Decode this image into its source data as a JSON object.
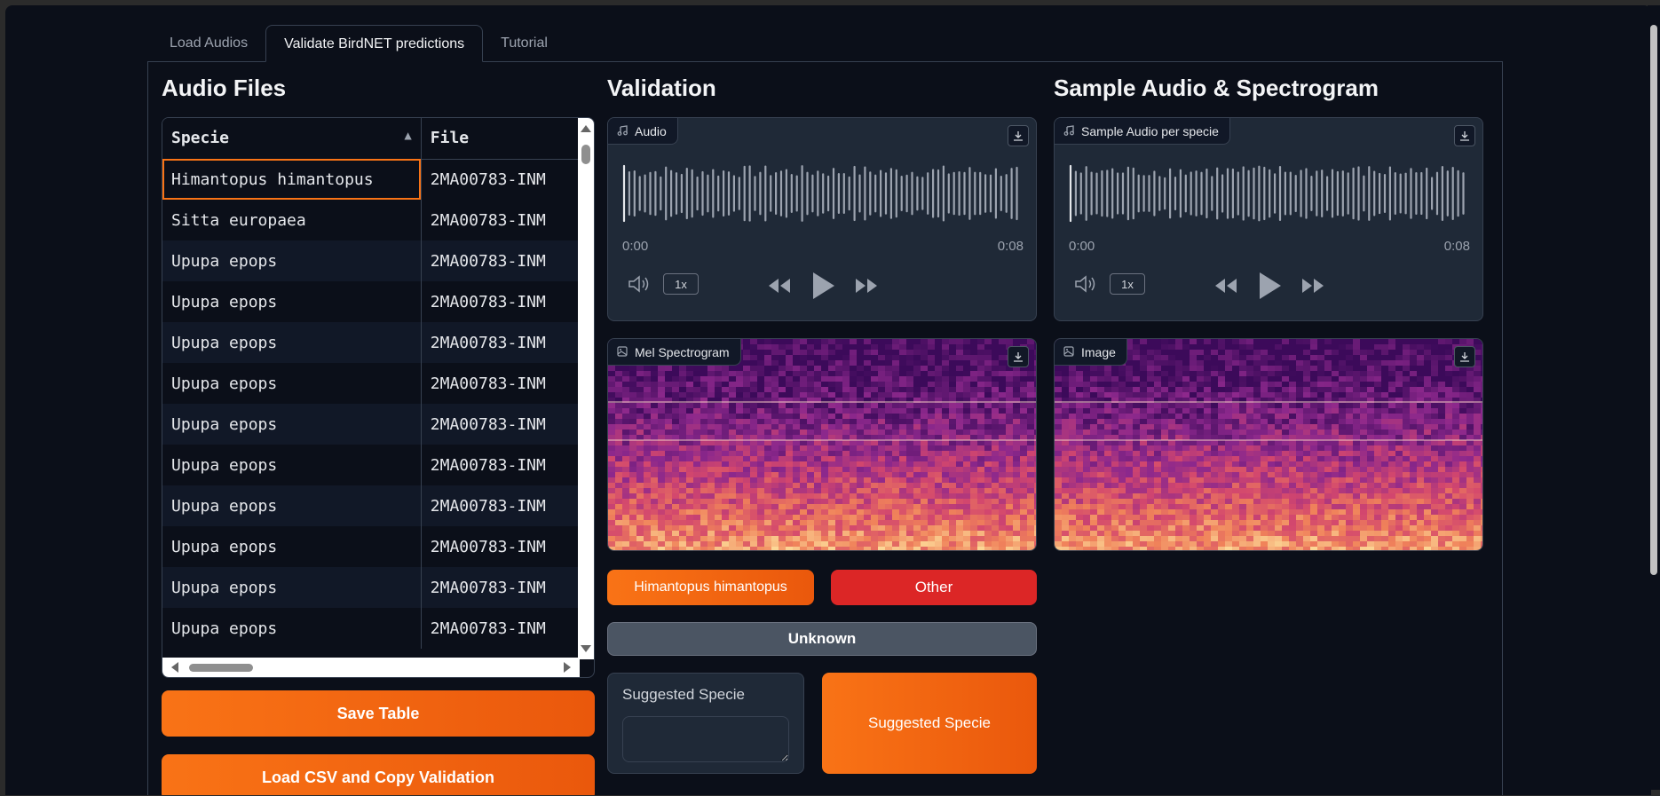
{
  "tabs": [
    "Load Audios",
    "Validate BirdNET predictions",
    "Tutorial"
  ],
  "active_tab": 1,
  "columns": {
    "audio_files": "Audio Files",
    "validation": "Validation",
    "sample": "Sample Audio & Spectrogram"
  },
  "table": {
    "headers": [
      "Specie",
      "File"
    ],
    "rows": [
      [
        "Himantopus himantopus",
        "2MA00783-INM"
      ],
      [
        "Sitta europaea",
        "2MA00783-INM"
      ],
      [
        "Upupa epops",
        "2MA00783-INM"
      ],
      [
        "Upupa epops",
        "2MA00783-INM"
      ],
      [
        "Upupa epops",
        "2MA00783-INM"
      ],
      [
        "Upupa epops",
        "2MA00783-INM"
      ],
      [
        "Upupa epops",
        "2MA00783-INM"
      ],
      [
        "Upupa epops",
        "2MA00783-INM"
      ],
      [
        "Upupa epops",
        "2MA00783-INM"
      ],
      [
        "Upupa epops",
        "2MA00783-INM"
      ],
      [
        "Upupa epops",
        "2MA00783-INM"
      ],
      [
        "Upupa epops",
        "2MA00783-INM"
      ]
    ]
  },
  "buttons": {
    "save_table": "Save Table",
    "load_csv": "Load CSV and Copy Validation",
    "himantopus": "Himantopus himantopus",
    "other": "Other",
    "unknown": "Unknown",
    "suggested_specie_btn": "Suggested Specie"
  },
  "audio_player": {
    "label": "Audio",
    "start": "0:00",
    "end": "0:08",
    "speed": "1x"
  },
  "sample_player": {
    "label": "Sample Audio per specie",
    "start": "0:00",
    "end": "0:08",
    "speed": "1x"
  },
  "mel_label": "Mel Spectrogram",
  "image_label": "Image",
  "suggested_label": "Suggested Specie",
  "icons": {
    "music": "music-note-icon",
    "image": "image-icon",
    "download": "download-icon",
    "volume": "volume-icon",
    "rewind": "rewind-icon",
    "play": "play-icon",
    "forward": "fast-forward-icon"
  },
  "colors": {
    "accent": "#f97316",
    "danger": "#dc2626",
    "background": "#0b0f19"
  }
}
